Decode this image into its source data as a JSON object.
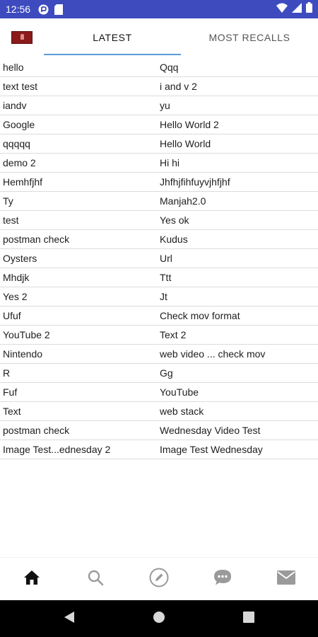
{
  "status_bar": {
    "time": "12:56",
    "left_icons": [
      "circle-app-icon",
      "sd-card-icon"
    ],
    "right_icons": [
      "wifi-icon",
      "signal-icon",
      "battery-icon"
    ],
    "background": "#3d4bbf"
  },
  "header": {
    "flag_icon": "flag-icon",
    "tabs": [
      {
        "label": "LATEST",
        "active": true
      },
      {
        "label": "MOST RECALLS",
        "active": false
      }
    ],
    "indicator_color": "#5b9bd8"
  },
  "table": {
    "rows": [
      {
        "left": "hello",
        "right": "Qqq"
      },
      {
        "left": "text test",
        "right": "i and v 2"
      },
      {
        "left": "iandv",
        "right": "yu"
      },
      {
        "left": "Google",
        "right": "Hello World 2"
      },
      {
        "left": "qqqqq",
        "right": "Hello World"
      },
      {
        "left": "demo 2",
        "right": "Hi hi"
      },
      {
        "left": "Hemhfjhf",
        "right": "Jhfhjfihfuyvjhfjhf"
      },
      {
        "left": "Ty",
        "right": "Manjah2.0"
      },
      {
        "left": "test",
        "right": "Yes ok"
      },
      {
        "left": "postman check",
        "right": "Kudus"
      },
      {
        "left": "Oysters",
        "right": "Url"
      },
      {
        "left": "Mhdjk",
        "right": "Ttt"
      },
      {
        "left": "Yes 2",
        "right": "Jt"
      },
      {
        "left": "Ufuf",
        "right": "Check mov format"
      },
      {
        "left": "YouTube 2",
        "right": "Text 2"
      },
      {
        "left": "Nintendo",
        "right": "web video ... check mov"
      },
      {
        "left": "R",
        "right": "Gg"
      },
      {
        "left": "Fuf",
        "right": "YouTube"
      },
      {
        "left": "Text",
        "right": "web stack"
      },
      {
        "left": "postman check",
        "right": "Wednesday Video Test"
      },
      {
        "left": "Image Test...ednesday 2",
        "right": "Image Test Wednesday"
      }
    ]
  },
  "bottom_nav": {
    "items": [
      "home-icon",
      "search-icon",
      "compose-icon",
      "chat-icon",
      "mail-icon"
    ],
    "active": "home-icon"
  },
  "system_nav": {
    "items": [
      "back-icon",
      "home-circle-icon",
      "recents-icon"
    ]
  }
}
